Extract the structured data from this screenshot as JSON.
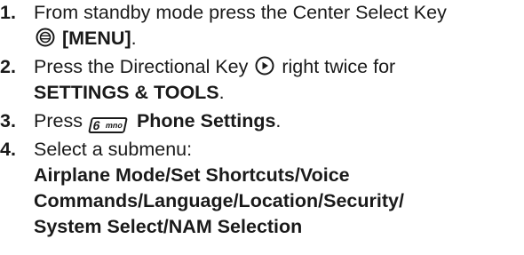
{
  "steps": [
    {
      "number": "1.",
      "text_a": "From standby mode press the Center Select Key",
      "icon": "center-select-key-icon",
      "bold": "[MENU]",
      "end": "."
    },
    {
      "number": "2.",
      "text_a": "Press the Directional Key",
      "icon": "directional-key-icon",
      "text_b": "right twice for",
      "bold": "SETTINGS & TOOLS",
      "end": "."
    },
    {
      "number": "3.",
      "text_a": "Press",
      "icon": "key-6-mno-icon",
      "key_digit": "6",
      "key_letters": "mno",
      "bold": "Phone Settings",
      "end": "."
    },
    {
      "number": "4.",
      "text_a": "Select a submenu:",
      "bold_lines": [
        "Airplane Mode/Set Shortcuts/Voice",
        "Commands/Language/Location/Security/",
        "System Select/NAM Selection"
      ]
    }
  ]
}
